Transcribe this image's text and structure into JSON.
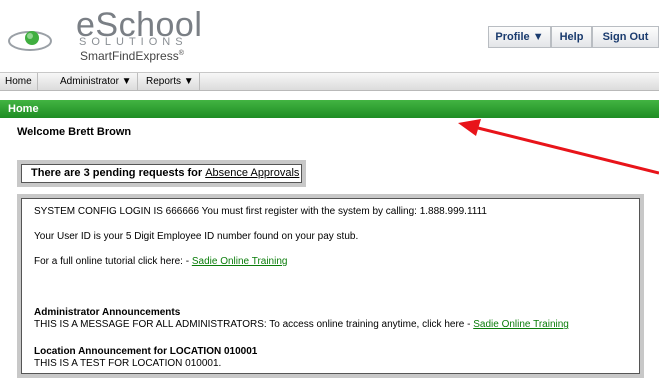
{
  "header": {
    "logo": {
      "name": "eSchool",
      "sub": "SOLUTIONS",
      "product": "SmartFindExpress",
      "mark": "®"
    },
    "nav": {
      "profile": "Profile ▼",
      "help": "Help",
      "signout": "Sign Out"
    }
  },
  "menubar": {
    "home": "Home",
    "administrator": "Administrator ▼",
    "reports": "Reports ▼"
  },
  "page_title": "Home",
  "welcome": "Welcome Brett Brown",
  "pending": {
    "text": "There are 3 pending requests for",
    "link": "Absence Approvals"
  },
  "content": {
    "line1": "SYSTEM CONFIG LOGIN IS 666666 You must first register with the system by calling: 1.888.999.1111",
    "line2": "Your User ID is your 5 Digit Employee ID number found on your pay stub.",
    "line3_text": "For a full online tutorial click here: - ",
    "line3_link": "Sadie Online Training",
    "admin_heading": "Administrator Announcements",
    "admin_text": "THIS IS A MESSAGE FOR ALL ADMINISTRATORS: To access online training anytime, click here - ",
    "admin_link": "Sadie Online Training",
    "loc_heading": "Location Announcement for LOCATION 010001",
    "loc_text": "THIS IS A TEST FOR LOCATION 010001."
  },
  "colors": {
    "green_bar": "#2a9d2f",
    "link_green": "#0a7d0a",
    "arrow_red": "#e8141a",
    "nav_text": "#1a3b6e"
  }
}
